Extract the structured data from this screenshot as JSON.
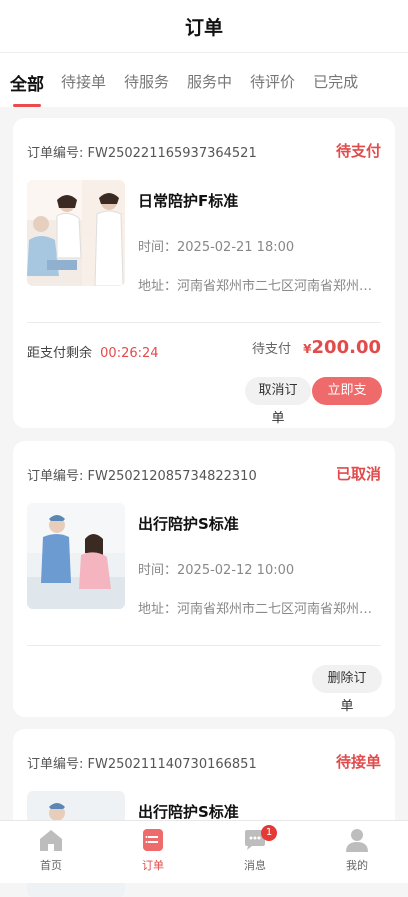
{
  "header": {
    "title": "订单"
  },
  "tabs": [
    {
      "label": "全部",
      "active": true
    },
    {
      "label": "待接单"
    },
    {
      "label": "待服务"
    },
    {
      "label": "服务中"
    },
    {
      "label": "待评价"
    },
    {
      "label": "已完成"
    }
  ],
  "orders": [
    {
      "order_no": "订单编号: FW250221165937364521",
      "status": "待支付",
      "service": "日常陪护F标准",
      "time": "时间：2025-02-21 18:00",
      "address": "地址：河南省郑州市二七区河南省郑州市二七区",
      "countdown_label": "距支付剩余",
      "countdown": "00:26:24",
      "price_label": "待支付",
      "currency": "¥",
      "price": "200.00",
      "buttons": [
        "取消订单",
        "立即支付"
      ]
    },
    {
      "order_no": "订单编号: FW250212085734822310",
      "status": "已取消",
      "service": "出行陪护S标准",
      "time": "时间：2025-02-12 10:00",
      "address": "地址：河南省郑州市二七区河南省郑州市二七区",
      "buttons": [
        "删除订单"
      ]
    },
    {
      "order_no": "订单编号: FW250211140730166851",
      "status": "待接单",
      "service": "出行陪护S标准"
    }
  ],
  "navbar": {
    "items": [
      {
        "label": "首页",
        "icon": "home-icon"
      },
      {
        "label": "订单",
        "icon": "order-icon",
        "active": true
      },
      {
        "label": "消息",
        "icon": "message-icon",
        "badge": "1"
      },
      {
        "label": "我的",
        "icon": "user-icon"
      }
    ]
  },
  "colors": {
    "accent": "#e24b4b",
    "button_red": "#ef6b6b"
  }
}
